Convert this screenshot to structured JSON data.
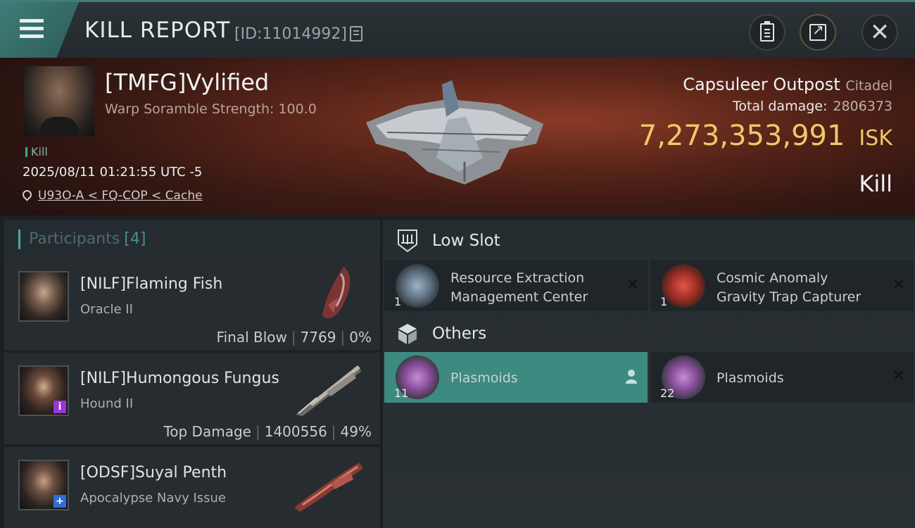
{
  "header": {
    "title": "KILL REPORT",
    "report_id": "[ID:11014992]",
    "icons": {
      "menu": "menu-icon",
      "copy": "copy-icon",
      "clipboard": "clipboard-icon",
      "share": "share-icon",
      "close": "close-icon"
    }
  },
  "victim": {
    "name": "[TMFG]Vylified",
    "scramble": "Warp Soramble Strength: 100.0",
    "tag": "Kill",
    "datetime": "2025/08/11 01:21:55 UTC -5",
    "location": "U93O-A < FQ-COP < Cache",
    "ship_type": "Capsuleer Outpost",
    "ship_class": "Citadel",
    "total_damage_label": "Total damage:",
    "total_damage_value": "2806373",
    "isk_value": "7,273,353,991",
    "isk_unit": "ISK",
    "result": "Kill"
  },
  "participants": {
    "label": "Participants",
    "count": "[4]",
    "rows": [
      {
        "name": "[NILF]Flaming Fish",
        "ship": "Oracle II",
        "role": "Final Blow",
        "damage": "7769",
        "percent": "0%"
      },
      {
        "name": "[NILF]Humongous Fungus",
        "ship": "Hound II",
        "role": "Top Damage",
        "damage": "1400556",
        "percent": "49%"
      },
      {
        "name": "[ODSF]Suyal Penth",
        "ship": "Apocalypse Navy Issue",
        "role": "",
        "damage": "",
        "percent": ""
      }
    ]
  },
  "fittings": {
    "low_slot_label": "Low Slot",
    "others_label": "Others",
    "low_slot": [
      {
        "name_line1": "Resource Extraction",
        "name_line2": "Management Center",
        "qty": "1"
      },
      {
        "name_line1": "Cosmic Anomaly",
        "name_line2": "Gravity Trap Capturer",
        "qty": "1"
      }
    ],
    "others": [
      {
        "name": "Plasmoids",
        "qty": "11"
      },
      {
        "name": "Plasmoids",
        "qty": "22"
      }
    ]
  },
  "colors": {
    "accent": "#3d8a80",
    "isk": "#f0c86a",
    "header_teal": "#3e7f7a"
  }
}
